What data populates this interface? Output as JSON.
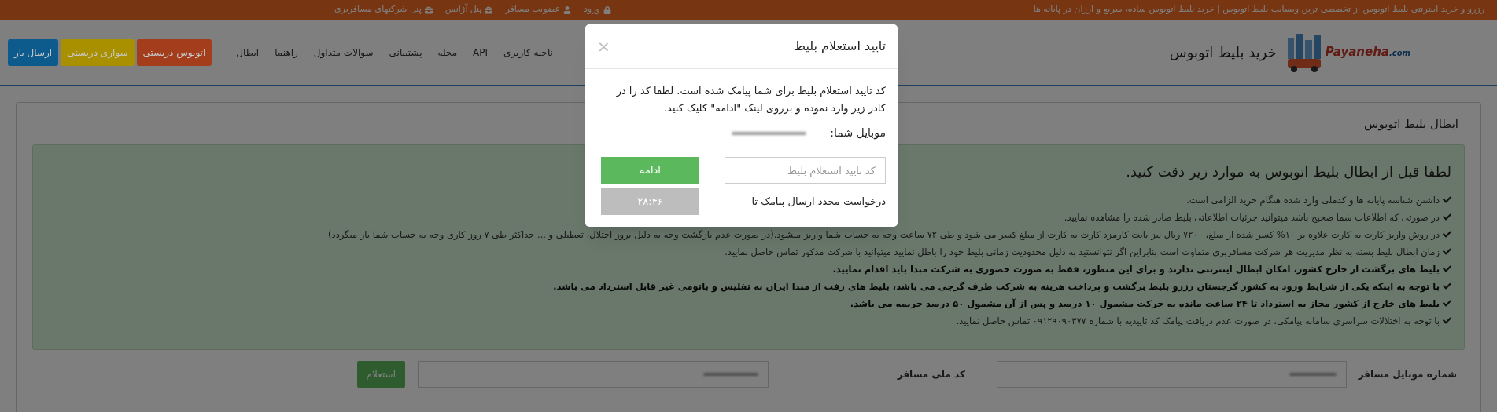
{
  "top_bar": {
    "tagline": "رزرو و خرید اینترنتی بلیط اتوبوس از تخصصی ترین وبسایت بلیط اتوبوس | خرید بلیط اتوبوس ساده، سریع و ارزان در پایانه ها",
    "links": [
      {
        "label": "ورود",
        "kind": "lock"
      },
      {
        "label": "عضویت مسافر",
        "kind": "user"
      },
      {
        "label": "پنل آژانس",
        "kind": "briefcase"
      },
      {
        "label": "پنل شرکتهای مسافربری",
        "kind": "briefcase"
      }
    ]
  },
  "header": {
    "logo_text": "Payaneha",
    "logo_domain": ".com",
    "brand": "خرید بلیط اتوبوس",
    "menu": [
      "ناحیه کاربری",
      "API",
      "مجله",
      "پشتیبانی",
      "سوالات متداول",
      "راهنما",
      "ابطال"
    ],
    "buttons": [
      {
        "label": "اتوبوس دربستی",
        "color": "#a33d1c"
      },
      {
        "label": "سواری دربستی",
        "color": "#a89000"
      },
      {
        "label": "ارسال بار",
        "color": "#0d5a8c"
      }
    ]
  },
  "section": {
    "title": "ابطال بلیط اتوبوس",
    "notice_heading": "لطفا قبل از ابطال بلیط اتوبوس به موارد زیر دقت کنید.",
    "notes": [
      {
        "text": "داشتن شناسه پایانه ها و کدملی وارد شده هنگام خرید الزامی است.",
        "bold": false
      },
      {
        "text": "در صورتی که اطلاعات شما صحیح باشد میتوانید جزئیات اطلاعاتی بلیط صادر شده را مشاهده نمایید.",
        "bold": false
      },
      {
        "text": "در روش واریز کارت به کارت علاوه بر ۱۰% کسر شده از مبلغ، ۷۲۰۰ ریال نیز بابت کارمزد کارت به کارت از مبلغ کسر می شود و طی ۷۲ ساعت وجه به حساب شما واریز میشود.(در صورت عدم بازگشت وجه به دلیل بروز اختلال، تعطیلی و ... حداکثر طی ۷ روز کاری وجه به حساب شما باز میگردد)",
        "bold": false
      },
      {
        "text": "زمان ابطال بلیط بسته به نظر مدیریت هر شرکت مسافربری متفاوت است بنابراین اگر نتوانستید به دلیل محدودیت زمانی بلیط خود را باطل نمایید میتوانید با شرکت مذکور تماس حاصل نمایید.",
        "bold": false
      },
      {
        "text": "بلیط های برگشت از خارج کشور، امکان ابطال اینترنتی ندارند و برای این منظور، فقط به صورت حضوری به شرکت مبدا باید اقدام نمایید.",
        "bold": true
      },
      {
        "text": "با توجه به اینکه یکی از شرایط ورود به کشور گرجستان رزرو بلیط برگشت و پرداخت هزینه به شرکت طرف گرجی می باشد، بلیط های رفت از مبدا ایران به تفلیس و باتومی غیر قابل استرداد می باشد.",
        "bold": true
      },
      {
        "text": "بلیط های خارج از کشور مجاز به استرداد تا ۲۴ ساعت مانده به حرکت مشمول ۱۰ درصد و پس از آن مشمول ۵۰ درصد جریمه می باشد.",
        "bold": true
      },
      {
        "text": "با توجه به اختلالات سراسری سامانه پیامکی، در صورت عدم دریافت پیامک کد تاییدیه با شماره ۰۹۱۲۹۰۹۰۳۷۷ تماس حاصل نمایید.",
        "bold": false
      }
    ],
    "form": {
      "mobile_label": "شماره موبایل مسافر",
      "national_id_label": "کد ملی مسافر",
      "submit": "استعلام"
    }
  },
  "modal": {
    "title": "تایید استعلام بلیط",
    "close": "×",
    "message": "کد تایید استعلام بلیط برای شما پیامک شده است. لطفا کد را در کادر زیر وارد نموده و برروی لینک \"ادامه\" کلیک کنید.",
    "mobile_label": "موبایل شما:",
    "code_placeholder": "کد تایید استعلام بلیط",
    "continue": "ادامه",
    "resend_text": "درخواست مجدد ارسال پیامک تا",
    "timer": "۲۸:۴۶",
    "timer_disabled": true
  }
}
